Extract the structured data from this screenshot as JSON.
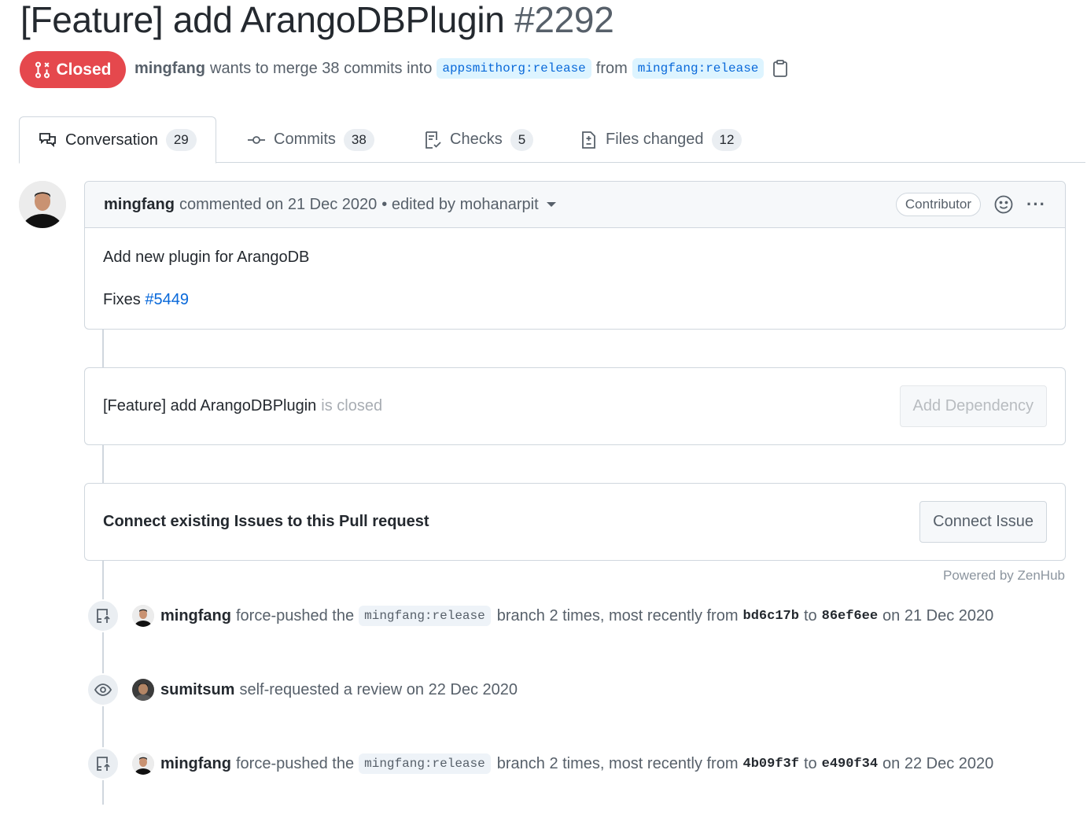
{
  "pr": {
    "title": "[Feature] add ArangoDBPlugin",
    "number": "#2292",
    "state": "Closed",
    "author": "mingfang",
    "merge_text": "wants to merge 38 commits into",
    "base_branch": "appsmithorg:release",
    "from_text": "from",
    "head_branch": "mingfang:release"
  },
  "tabs": [
    {
      "label": "Conversation",
      "count": "29"
    },
    {
      "label": "Commits",
      "count": "38"
    },
    {
      "label": "Checks",
      "count": "5"
    },
    {
      "label": "Files changed",
      "count": "12"
    }
  ],
  "comment": {
    "author": "mingfang",
    "commented": "commented on 21 Dec 2020",
    "edited": "• edited by mohanarpit",
    "badge": "Contributor",
    "body_line1": "Add new plugin for ArangoDB",
    "fixes_label": "Fixes",
    "fixes_link": "#5449"
  },
  "dependency": {
    "title": "[Feature] add ArangoDBPlugin",
    "status": "is closed",
    "button": "Add Dependency"
  },
  "connect": {
    "text": "Connect existing Issues to this Pull request",
    "button": "Connect Issue",
    "powered": "Powered by ZenHub"
  },
  "events": [
    {
      "who": "mingfang",
      "pre": "force-pushed the",
      "branch": "mingfang:release",
      "mid": "branch 2 times, most recently from",
      "sha_from": "bd6c17b",
      "to": "to",
      "sha_to": "86ef6ee",
      "date": "on 21 Dec 2020"
    },
    {
      "who": "sumitsum",
      "text": "self-requested a review on 22 Dec 2020"
    },
    {
      "who": "mingfang",
      "pre": "force-pushed the",
      "branch": "mingfang:release",
      "mid": "branch 2 times, most recently from",
      "sha_from": "4b09f3f",
      "to": "to",
      "sha_to": "e490f34",
      "date": "on 22 Dec 2020"
    }
  ],
  "colors": {
    "closed": "#e5484d",
    "link": "#0969da",
    "border": "#d0d7de"
  }
}
